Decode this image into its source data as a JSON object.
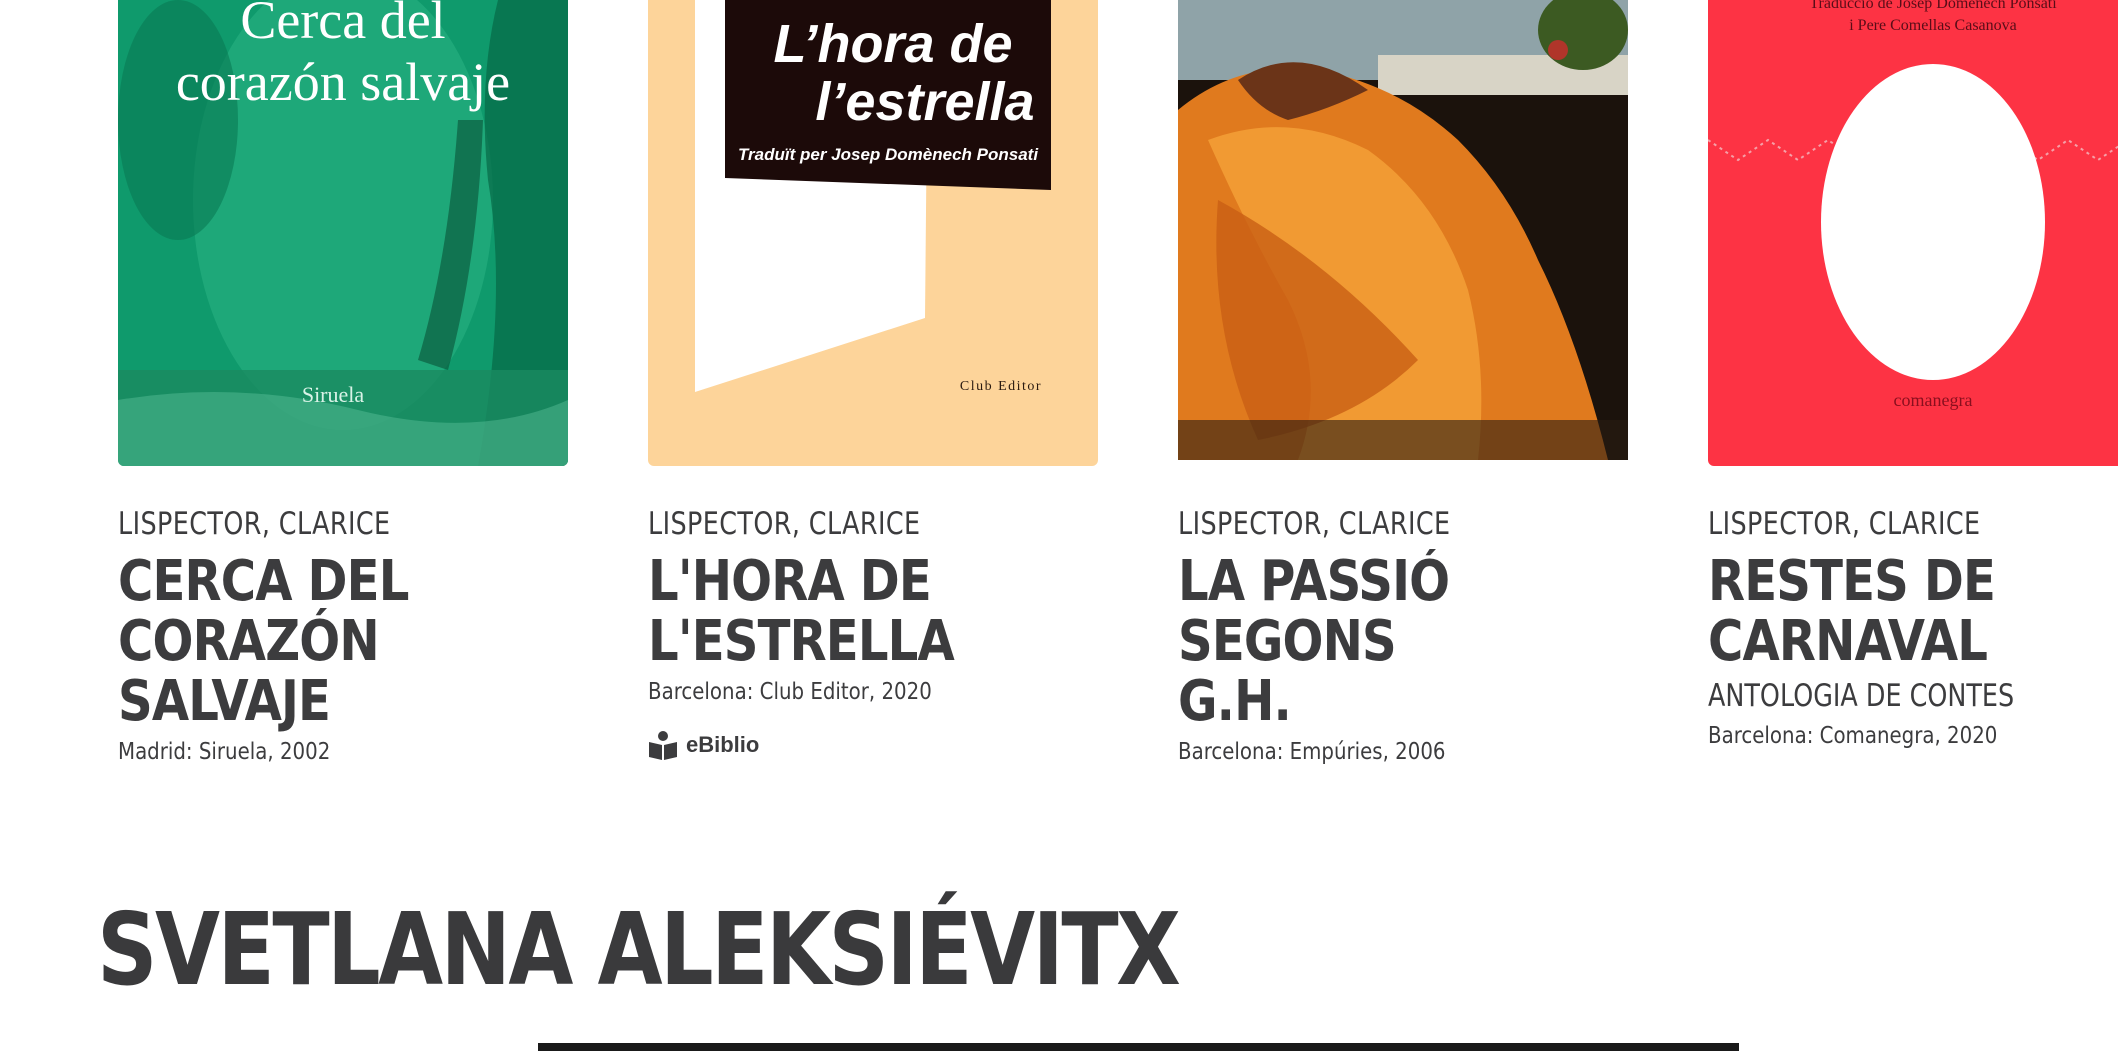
{
  "books": [
    {
      "author": "LISPECTOR, CLARICE",
      "title_line1": "CERCA DEL",
      "title_line2": "CORAZÓN SALVAJE",
      "subtitle": "",
      "publication": "Madrid: Siruela, 2002",
      "cover": {
        "title_line1": "Cerca del",
        "title_line2": "corazón salvaje",
        "publisher": "Siruela",
        "color": "#0f9a6c"
      }
    },
    {
      "author": "LISPECTOR, CLARICE",
      "title_line1": "L'HORA DE",
      "title_line2": "L'ESTRELLA",
      "subtitle": "",
      "publication": "Barcelona: Club Editor, 2020",
      "badge": "eBiblio",
      "cover": {
        "title_line1": "L’hora de",
        "title_line2": "l’estrella",
        "translator": "Traduït per Josep Domènech Ponsati",
        "publisher": "Club Editor",
        "color": "#fdd49a"
      }
    },
    {
      "author": "LISPECTOR, CLARICE",
      "title_line1": "LA PASSIÓ SEGONS",
      "title_line2": "G.H.",
      "subtitle": "",
      "publication": "Barcelona: Empúries, 2006",
      "cover": {
        "color": "#d9751f"
      }
    },
    {
      "author": "LISPECTOR, CLARICE",
      "title_line1": "RESTES DE",
      "title_line2": "CARNAVAL",
      "subtitle": "ANTOLOGIA DE CONTES",
      "publication": "Barcelona: Comanegra, 2020",
      "cover": {
        "translator_line1": "Traducció de Josep Domènech Ponsati",
        "translator_line2": "i Pere Comellas Casanova",
        "publisher": "comanegra",
        "color": "#fd3344"
      }
    }
  ],
  "next_section": {
    "heading": "SVETLANA ALEKSIÉVITX"
  },
  "icons": {
    "ebiblio": "reading-person-icon"
  }
}
